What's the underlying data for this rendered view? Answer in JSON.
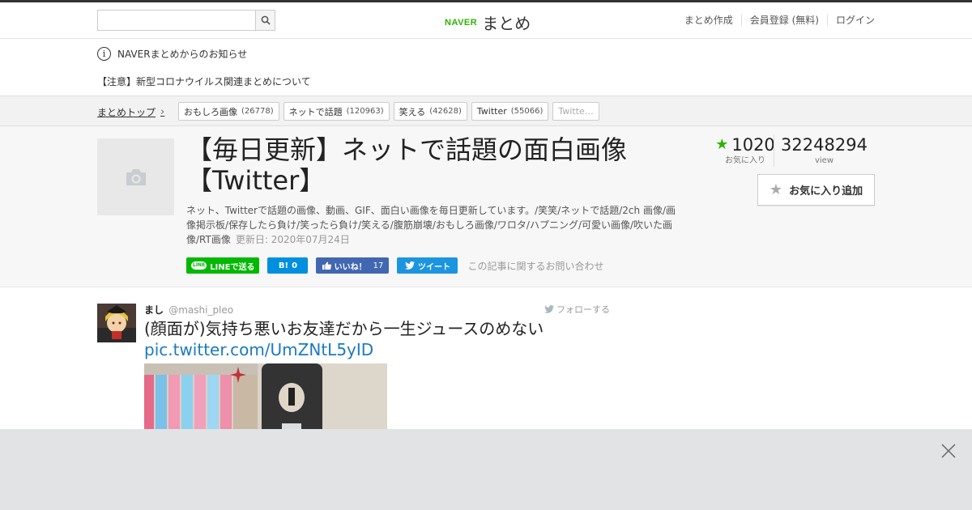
{
  "header": {
    "search_placeholder": "",
    "logo_naver": "NAVER",
    "logo_matome": "まとめ",
    "links": [
      "まとめ作成",
      "会員登録 (無料)",
      "ログイン"
    ]
  },
  "notice": {
    "heading": "NAVERまとめからのお知らせ",
    "item": "【注意】新型コロナウイルス関連まとめについて"
  },
  "breadcrumb": {
    "top": "まとめトップ",
    "tags": [
      {
        "label": "おもしろ画像",
        "count": "(26778)"
      },
      {
        "label": "ネットで話題",
        "count": "(120963)"
      },
      {
        "label": "笑える",
        "count": "(42628)"
      },
      {
        "label": "Twitter",
        "count": "(55066)"
      },
      {
        "label": "Twitte…",
        "count": ""
      }
    ]
  },
  "article": {
    "title_line1": "【毎日更新】ネットで話題の面白画像",
    "title_line2": "【Twitter】",
    "description": "ネット、Twitterで話題の画像、動画、GIF、面白い画像を毎日更新しています。/笑笑/ネットで話題/2ch 画像/画像掲示板/保存したら負け/笑ったら負け/笑える/腹筋崩壊/おもしろ画像/ワロタ/ハプニング/可愛い画像/吹いた画像/RT画像",
    "updated": "更新日: 2020年07月24日",
    "share": {
      "line": "LINEで送る",
      "hatena_icon": "B!",
      "hatena_count": "0",
      "facebook": "いいね！",
      "facebook_count": "17",
      "twitter": "ツイート",
      "contact": "この記事に関するお問い合わせ"
    },
    "stats": {
      "favorites": "1020",
      "favorites_label": "お気に入り",
      "views": "32248294",
      "views_label": "view"
    },
    "fav_button": "お気に入り追加"
  },
  "tweet": {
    "name": "まし",
    "handle": "@mashi_pleo",
    "follow": "フォローする",
    "text": "(顔面が)気持ち悪いお友達だから一生ジュースのめない",
    "link": "pic.twitter.com/UmZNtL5yID"
  },
  "colors": {
    "naver_green": "#2db400",
    "line_green": "#00b900",
    "hatena_blue": "#008fde",
    "facebook_blue": "#4267b2",
    "twitter_blue": "#1b95e0",
    "link_blue": "#1b7ac0"
  }
}
